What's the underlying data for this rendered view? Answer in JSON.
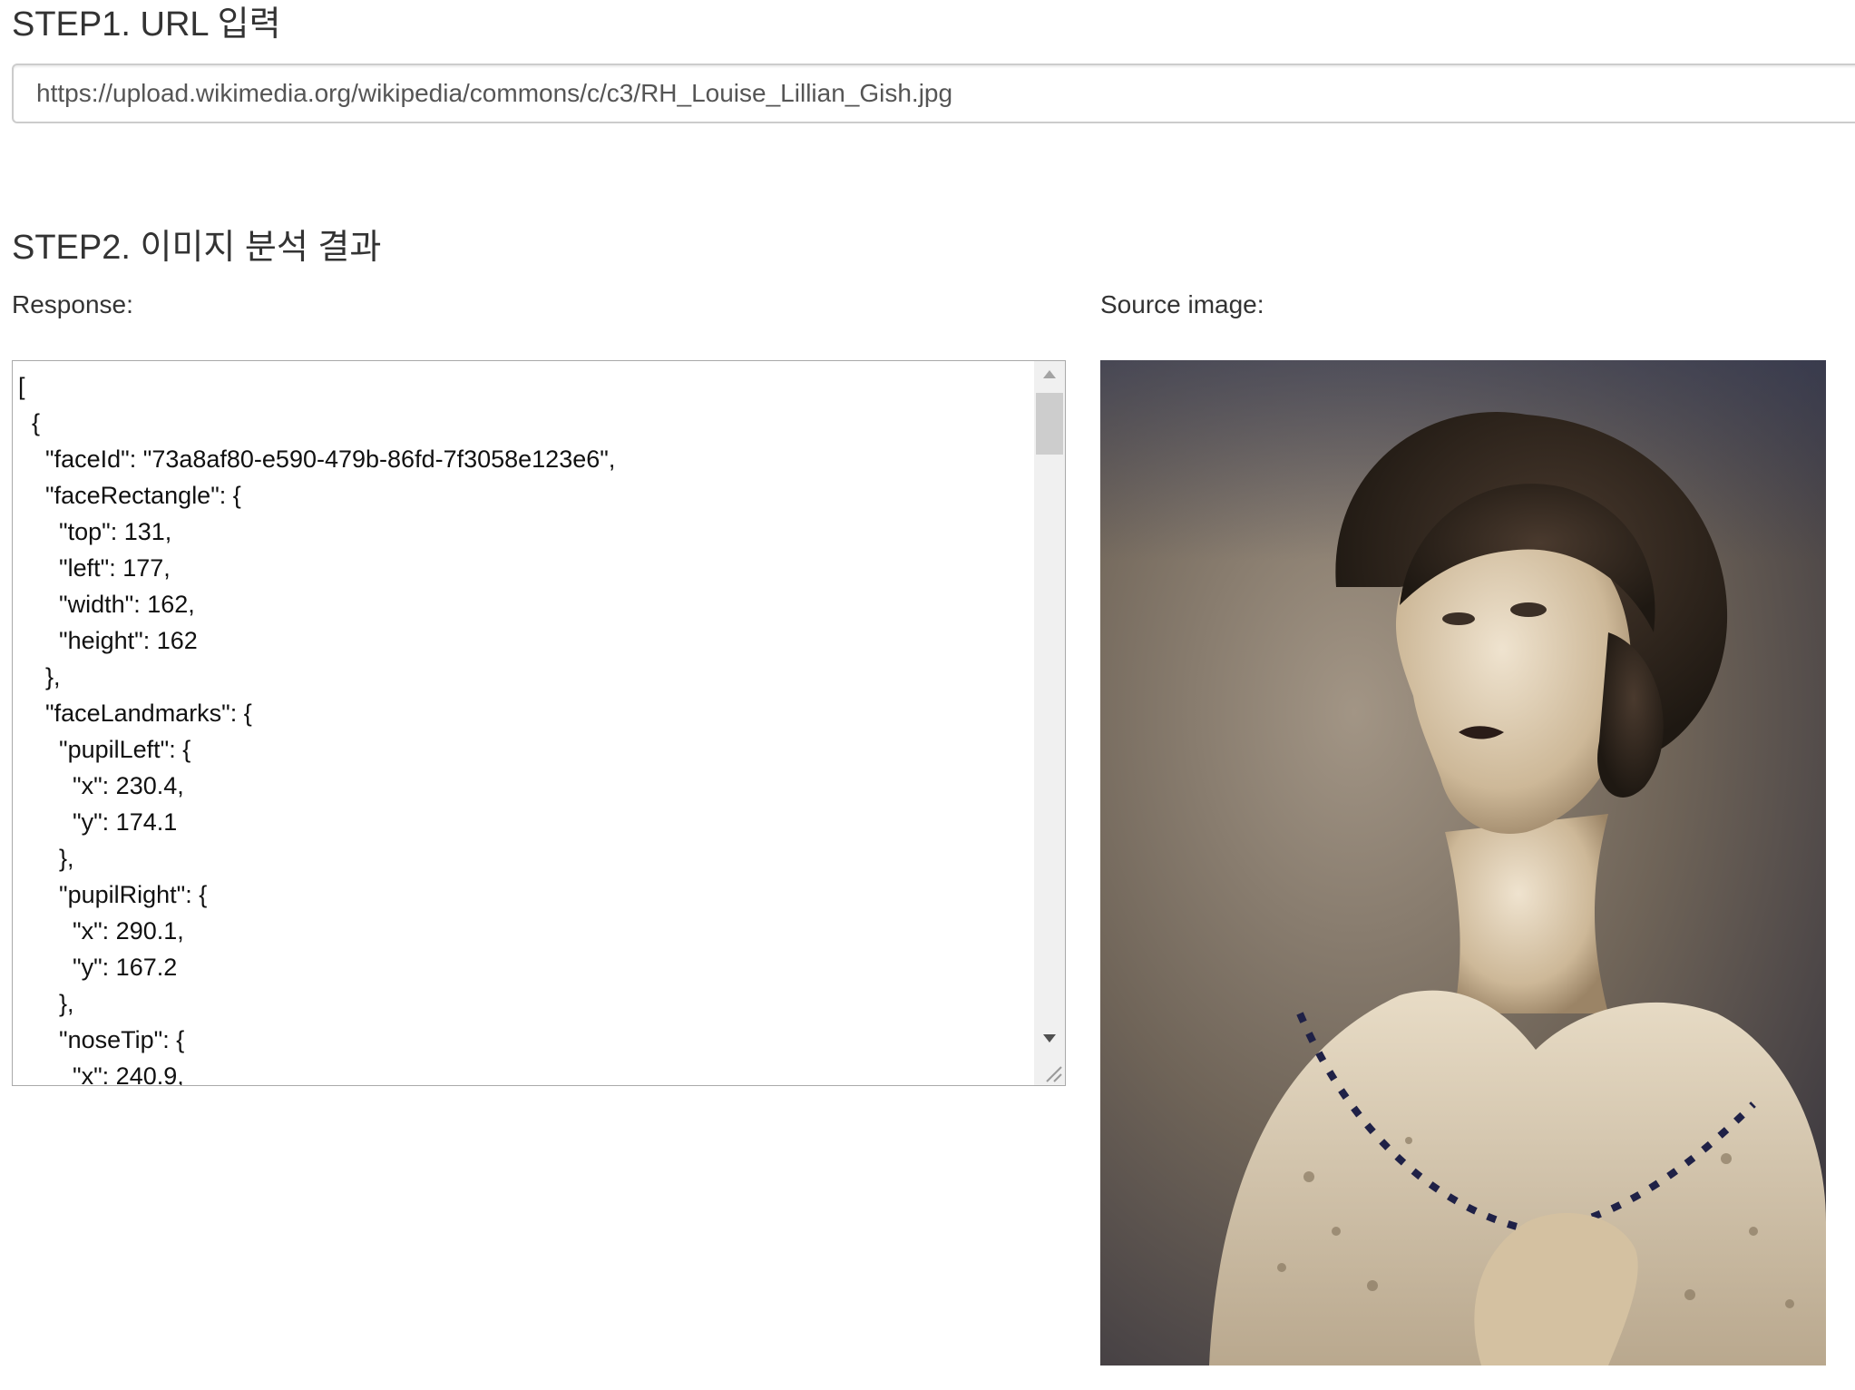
{
  "step1": {
    "title": "STEP1. URL 입력",
    "url_value": "https://upload.wikimedia.org/wikipedia/commons/c/c3/RH_Louise_Lillian_Gish.jpg"
  },
  "step2": {
    "title": "STEP2. 이미지 분석 결과",
    "response_label": "Response:",
    "source_label": "Source image:",
    "response_text": "[\n  {\n    \"faceId\": \"73a8af80-e590-479b-86fd-7f3058e123e6\",\n    \"faceRectangle\": {\n      \"top\": 131,\n      \"left\": 177,\n      \"width\": 162,\n      \"height\": 162\n    },\n    \"faceLandmarks\": {\n      \"pupilLeft\": {\n        \"x\": 230.4,\n        \"y\": 174.1\n      },\n      \"pupilRight\": {\n        \"x\": 290.1,\n        \"y\": 167.2\n      },\n      \"noseTip\": {\n        \"x\": 240.9,"
  },
  "icons": {
    "scroll_up": "scroll-up-arrow-icon",
    "scroll_down": "scroll-down-arrow-icon",
    "resize": "resize-grip-icon"
  },
  "colors": {
    "text": "#333333",
    "input_border": "#cccccc",
    "photo_sepia_dark": "#3a2e25",
    "photo_sepia_light": "#e8ddc9"
  }
}
